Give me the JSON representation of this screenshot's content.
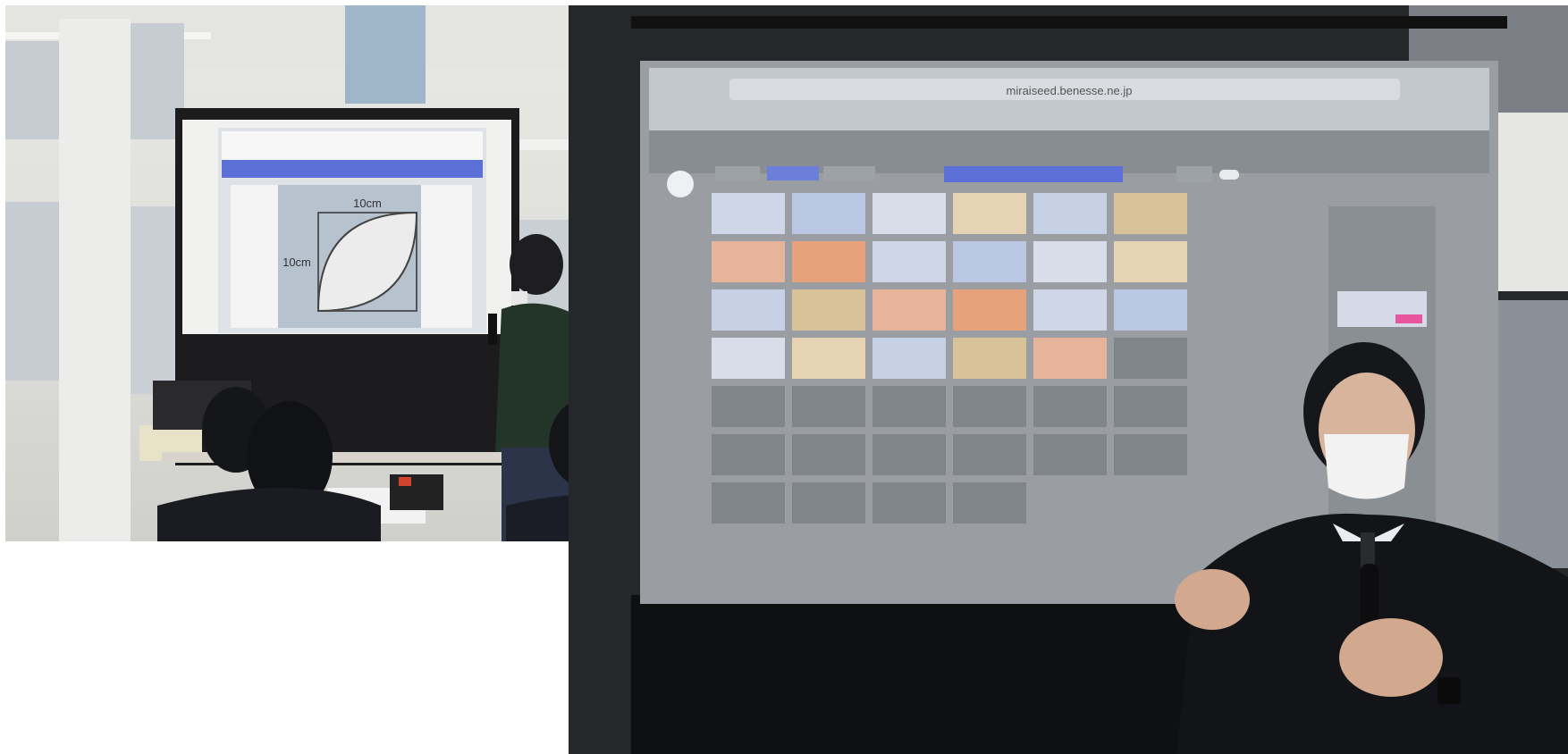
{
  "left_photo": {
    "slide": {
      "width_label": "10cm",
      "height_label": "10cm"
    }
  },
  "right_photo": {
    "projected_ui": {
      "url": "miraiseed.benesse.ne.jp",
      "colors": {
        "screen_bg": "#8e9396",
        "tile_empty": "#7f858a",
        "accent_blue": "#5d6fd8",
        "accent_pink": "#e8559d"
      },
      "tiles": {
        "thumbnail_count": 23,
        "empty_count": 17
      }
    }
  }
}
